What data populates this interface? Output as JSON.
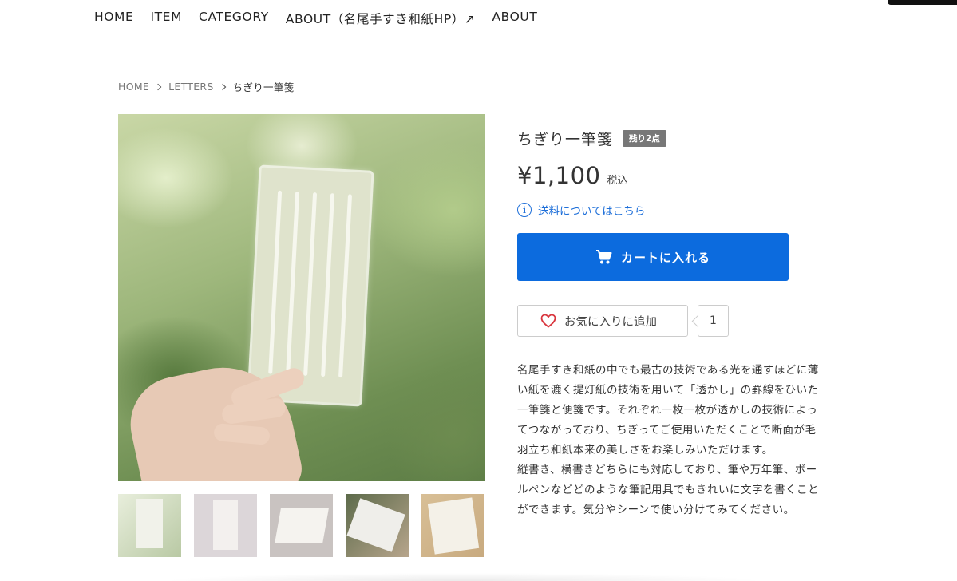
{
  "nav": {
    "items": [
      {
        "label": "HOME"
      },
      {
        "label": "ITEM"
      },
      {
        "label": "CATEGORY"
      },
      {
        "label": "ABOUT（名尾手すき和紙HP）↗"
      },
      {
        "label": "ABOUT"
      }
    ]
  },
  "breadcrumb": {
    "home": "HOME",
    "category": "LETTERS",
    "current": "ちぎり一筆箋"
  },
  "product": {
    "title": "ちぎり一筆箋",
    "stock_badge": "残り2点",
    "price": "¥1,100",
    "tax_label": "税込",
    "shipping_link": "送料についてはこちら",
    "cart_button": "カートに入れる",
    "favorite_button": "お気に入りに追加",
    "favorite_count": "1",
    "description": [
      "名尾手すき和紙の中でも最古の技術である光を通すほどに薄い紙を漉く提灯紙の技術を用いて「透かし」の罫線をひいた一筆箋と便箋です。それぞれ一枚一枚が透かしの技術によってつながっており、ちぎってご使用いただくことで断面が毛羽立ち和紙本来の美しさをお楽しみいただけます。",
      "縦書き、横書きどちらにも対応しており、筆や万年筆、ボールペンなどどのような筆記用具でもきれいに文字を書くことができます。気分やシーンで使い分けてみてください。"
    ]
  },
  "colors": {
    "accent": "#0c6bde",
    "link": "#1e6fd9",
    "badge": "#777777",
    "heart": "#d9363e"
  },
  "icons": {
    "info": "info-icon",
    "cart": "cart-icon",
    "heart": "heart-icon",
    "chevron": "chevron-right-icon"
  }
}
